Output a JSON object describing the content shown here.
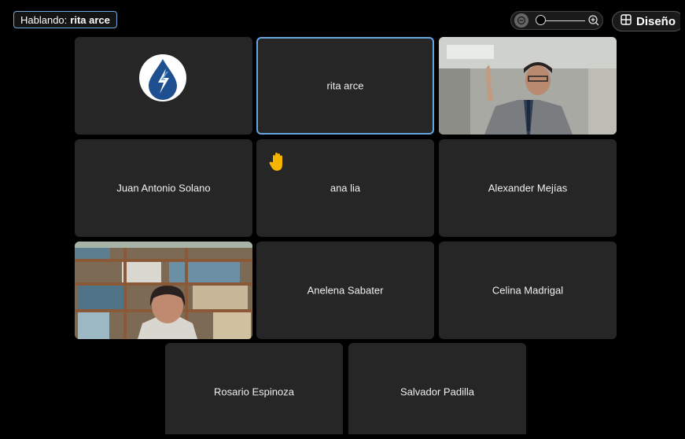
{
  "speaker": {
    "prefix": "Hablando:",
    "name": "rita arce"
  },
  "toolbar": {
    "layout_label": "Diseño"
  },
  "colors": {
    "active_border": "#65a5e2",
    "tile_bg": "#262626",
    "hand": "#f4b400"
  },
  "participants": [
    {
      "name": "",
      "type": "logo"
    },
    {
      "name": "rita arce",
      "type": "name",
      "active": true
    },
    {
      "name": "",
      "type": "video"
    },
    {
      "name": "Juan Antonio Solano",
      "type": "name"
    },
    {
      "name": "ana lia",
      "type": "name",
      "hand_raised": true
    },
    {
      "name": "Alexander Mejías",
      "type": "name"
    },
    {
      "name": "",
      "type": "video"
    },
    {
      "name": "Anelena Sabater",
      "type": "name"
    },
    {
      "name": "Celina Madrigal",
      "type": "name"
    },
    {
      "name": "Rosario Espinoza",
      "type": "name"
    },
    {
      "name": "Salvador Padilla",
      "type": "name"
    }
  ]
}
